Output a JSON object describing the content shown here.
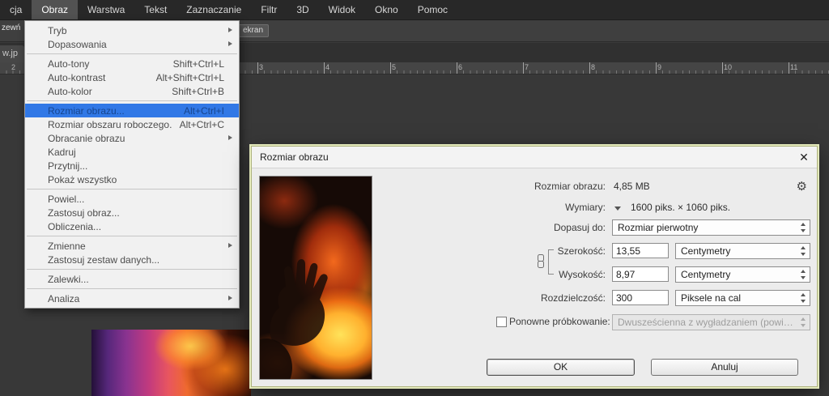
{
  "menubar": {
    "items": [
      {
        "label": "cja"
      },
      {
        "label": "Obraz",
        "active": true
      },
      {
        "label": "Warstwa"
      },
      {
        "label": "Tekst"
      },
      {
        "label": "Zaznaczanie"
      },
      {
        "label": "Filtr"
      },
      {
        "label": "3D"
      },
      {
        "label": "Widok"
      },
      {
        "label": "Okno"
      },
      {
        "label": "Pomoc"
      }
    ]
  },
  "options_bar": {
    "panel_fragment": "zewń",
    "screen_button": "ekran"
  },
  "document_tab": {
    "label": "w.jp"
  },
  "ruler": {
    "numbers": [
      "2",
      "3",
      "4",
      "5",
      "6",
      "7",
      "8",
      "9",
      "10",
      "11"
    ]
  },
  "image_menu": {
    "items": [
      {
        "label": "Tryb",
        "submenu": true
      },
      {
        "label": "Dopasowania",
        "submenu": true
      },
      {
        "separator": true
      },
      {
        "label": "Auto-tony",
        "shortcut": "Shift+Ctrl+L"
      },
      {
        "label": "Auto-kontrast",
        "shortcut": "Alt+Shift+Ctrl+L"
      },
      {
        "label": "Auto-kolor",
        "shortcut": "Shift+Ctrl+B"
      },
      {
        "separator": true
      },
      {
        "label": "Rozmiar obrazu...",
        "shortcut": "Alt+Ctrl+I",
        "highlighted": true
      },
      {
        "label": "Rozmiar obszaru roboczego...",
        "shortcut": "Alt+Ctrl+C"
      },
      {
        "label": "Obracanie obrazu",
        "submenu": true
      },
      {
        "label": "Kadruj"
      },
      {
        "label": "Przytnij..."
      },
      {
        "label": "Pokaż wszystko"
      },
      {
        "separator": true
      },
      {
        "label": "Powiel..."
      },
      {
        "label": "Zastosuj obraz..."
      },
      {
        "label": "Obliczenia..."
      },
      {
        "separator": true
      },
      {
        "label": "Zmienne",
        "submenu": true
      },
      {
        "label": "Zastosuj zestaw danych..."
      },
      {
        "separator": true
      },
      {
        "label": "Zalewki..."
      },
      {
        "separator": true
      },
      {
        "label": "Analiza",
        "submenu": true
      }
    ]
  },
  "dialog": {
    "title": "Rozmiar obrazu",
    "close_icon": "✕",
    "gear_icon": "⚙",
    "image_size_label": "Rozmiar obrazu:",
    "image_size_value": "4,85 MB",
    "dimensions_label": "Wymiary:",
    "dimensions_value": "1600 piks. × 1060 piks.",
    "fit_to_label": "Dopasuj do:",
    "fit_to_value": "Rozmiar pierwotny",
    "width_label": "Szerokość:",
    "width_value": "13,55",
    "width_unit": "Centymetry",
    "height_label": "Wysokość:",
    "height_value": "8,97",
    "height_unit": "Centymetry",
    "resolution_label": "Rozdzielczość:",
    "resolution_value": "300",
    "resolution_unit": "Piksele na cal",
    "resample_label": "Ponowne próbkowanie:",
    "resample_value": "Dwusześcienna z wygładzaniem (powięk...",
    "ok_label": "OK",
    "cancel_label": "Anuluj"
  },
  "colors": {
    "menu_highlight": "#3178e6",
    "dialog_glow": "#e3e9bb",
    "ui_dark": "#282828"
  }
}
